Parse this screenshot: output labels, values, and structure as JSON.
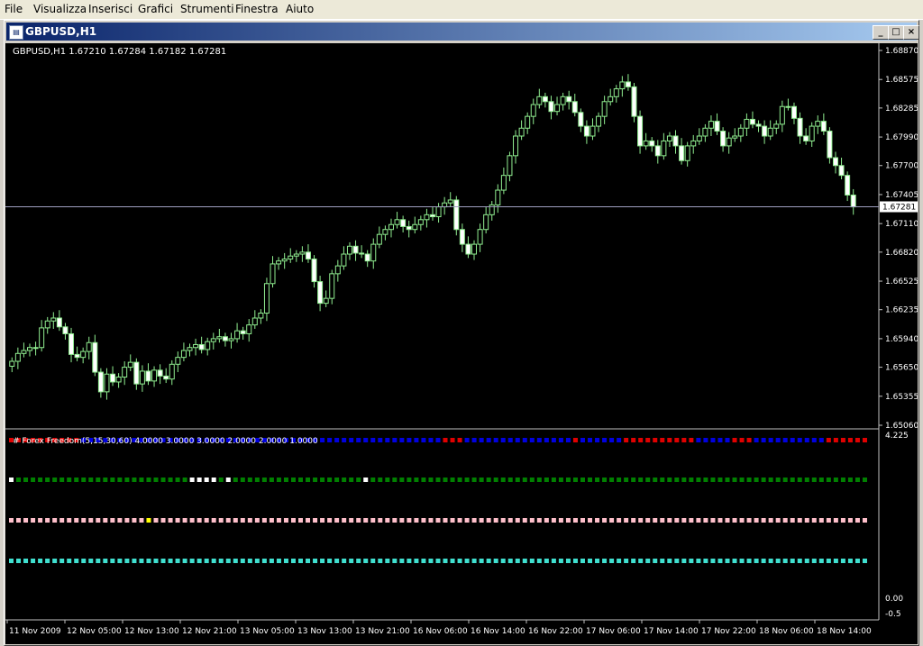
{
  "menu": [
    "File",
    "Visualizza",
    "Inserisci",
    "Grafici",
    "Strumenti",
    "Finestra",
    "Aiuto"
  ],
  "window": {
    "title": "GBPUSD,H1",
    "minimize_symbol": "_",
    "maximize_symbol": "□",
    "close_symbol": "×"
  },
  "chart_data": [
    {
      "type": "candlestick",
      "symbol": "GBPUSD,H1",
      "ohlc_header": "GBPUSD,H1  1.67210 1.67284 1.67182 1.67281",
      "current_price": "1.67281",
      "y_ticks": [
        "1.68870",
        "1.68575",
        "1.68285",
        "1.67990",
        "1.67700",
        "1.67405",
        "1.67110",
        "1.66820",
        "1.66525",
        "1.66235",
        "1.65940",
        "1.65650",
        "1.65355",
        "1.65060"
      ],
      "ylim": [
        1.6506,
        1.6887
      ],
      "x_ticks": [
        "11 Nov 2009",
        "12 Nov 05:00",
        "12 Nov 13:00",
        "12 Nov 21:00",
        "13 Nov 05:00",
        "13 Nov 13:00",
        "13 Nov 21:00",
        "16 Nov 06:00",
        "16 Nov 14:00",
        "16 Nov 22:00",
        "17 Nov 06:00",
        "17 Nov 14:00",
        "17 Nov 22:00",
        "18 Nov 06:00",
        "18 Nov 14:00"
      ],
      "closes": [
        1.6571,
        1.6579,
        1.6582,
        1.6585,
        1.6585,
        1.6605,
        1.6612,
        1.6615,
        1.6606,
        1.6599,
        1.6578,
        1.6575,
        1.6581,
        1.659,
        1.656,
        1.654,
        1.6558,
        1.655,
        1.6555,
        1.6565,
        1.657,
        1.6548,
        1.6561,
        1.6551,
        1.6562,
        1.6556,
        1.6553,
        1.6568,
        1.6575,
        1.6582,
        1.6585,
        1.6588,
        1.6583,
        1.6591,
        1.6594,
        1.6596,
        1.6592,
        1.6594,
        1.6602,
        1.6599,
        1.6608,
        1.6615,
        1.662,
        1.665,
        1.667,
        1.6673,
        1.6675,
        1.6678,
        1.668,
        1.6682,
        1.6675,
        1.6652,
        1.663,
        1.6635,
        1.666,
        1.6668,
        1.668,
        1.6688,
        1.6681,
        1.668,
        1.6673,
        1.669,
        1.67,
        1.6705,
        1.671,
        1.6715,
        1.6708,
        1.6705,
        1.671,
        1.6715,
        1.672,
        1.6718,
        1.6728,
        1.6732,
        1.6735,
        1.6705,
        1.669,
        1.668,
        1.669,
        1.6705,
        1.672,
        1.673,
        1.6745,
        1.676,
        1.678,
        1.68,
        1.6808,
        1.682,
        1.6832,
        1.684,
        1.6835,
        1.6825,
        1.6832,
        1.684,
        1.6835,
        1.6824,
        1.681,
        1.68,
        1.681,
        1.682,
        1.6835,
        1.684,
        1.6848,
        1.6855,
        1.685,
        1.682,
        1.679,
        1.6795,
        1.679,
        1.678,
        1.6795,
        1.68,
        1.679,
        1.6775,
        1.679,
        1.6795,
        1.68,
        1.6808,
        1.6815,
        1.6805,
        1.679,
        1.6798,
        1.68,
        1.6808,
        1.6817,
        1.6812,
        1.681,
        1.68,
        1.6808,
        1.6812,
        1.683,
        1.683,
        1.6818,
        1.68,
        1.6795,
        1.681,
        1.6815,
        1.6805,
        1.6778,
        1.677,
        1.676,
        1.674,
        1.6728
      ],
      "indicator_label": "# Forex Freedom(5,15,30,60) 4.0000 3.0000 3.0000 2.0000 2.0000 1.0000",
      "indicator_y_ticks": [
        "4.225",
        "0.00",
        "-0.5"
      ],
      "indicator_rows": [
        {
          "segments": [
            [
              0,
              9,
              "#e00000"
            ],
            [
              10,
              59,
              "#0000e0"
            ],
            [
              60,
              62,
              "#e00000"
            ],
            [
              63,
              77,
              "#0000e0"
            ],
            [
              78,
              78,
              "#e00000"
            ],
            [
              79,
              84,
              "#0000e0"
            ],
            [
              85,
              94,
              "#e00000"
            ],
            [
              95,
              99,
              "#0000e0"
            ],
            [
              100,
              102,
              "#e00000"
            ],
            [
              103,
              112,
              "#0000e0"
            ],
            [
              113,
              118,
              "#e00000"
            ]
          ]
        },
        {
          "segments": [
            [
              0,
              0,
              "#ffffff"
            ],
            [
              1,
              24,
              "#008000"
            ],
            [
              25,
              28,
              "#ffffff"
            ],
            [
              29,
              29,
              "#008000"
            ],
            [
              30,
              30,
              "#ffffff"
            ],
            [
              31,
              48,
              "#008000"
            ],
            [
              49,
              49,
              "#ffffff"
            ],
            [
              50,
              118,
              "#008000"
            ]
          ]
        },
        {
          "segments": [
            [
              0,
              18,
              "#ffc0cb"
            ],
            [
              19,
              19,
              "#ffff00"
            ],
            [
              20,
              118,
              "#ffc0cb"
            ]
          ]
        },
        {
          "segments": [
            [
              0,
              118,
              "#40e0d0"
            ]
          ]
        }
      ]
    }
  ],
  "colors": {
    "candle": "#90ee90",
    "bull_fill": "#000000",
    "bear_fill": "#ffffff",
    "grid_line": "#c0c0c0",
    "axis_text": "#ffffff"
  }
}
